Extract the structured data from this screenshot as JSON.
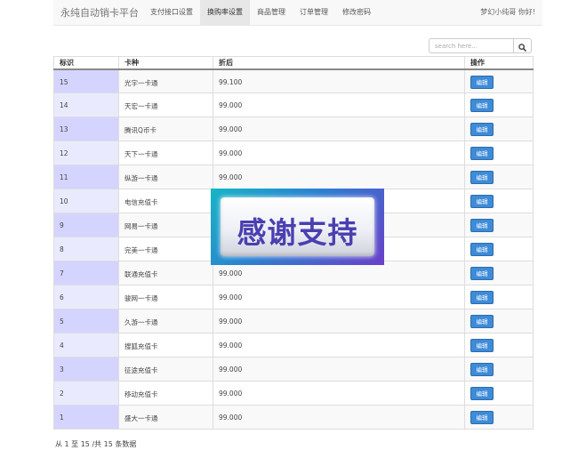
{
  "navbar": {
    "brand": "永纯自动销卡平台",
    "items": [
      {
        "label": "支付接口设置"
      },
      {
        "label": "换购率设置"
      },
      {
        "label": "商品管理"
      },
      {
        "label": "订单管理"
      },
      {
        "label": "修改密码"
      }
    ],
    "user_greeting": "梦幻小纯哥 你好!"
  },
  "search": {
    "placeholder": "search here..."
  },
  "table": {
    "columns": [
      "标识",
      "卡种",
      "折后",
      "操作"
    ],
    "edit_label": "编辑",
    "rows": [
      {
        "id": "15",
        "card": "光宇一卡通",
        "rate": "99.100"
      },
      {
        "id": "14",
        "card": "天宏一卡通",
        "rate": "99.000"
      },
      {
        "id": "13",
        "card": "腾讯Q币卡",
        "rate": "99.000"
      },
      {
        "id": "12",
        "card": "天下一卡通",
        "rate": "99.000"
      },
      {
        "id": "11",
        "card": "纵游一卡通",
        "rate": "99.000"
      },
      {
        "id": "10",
        "card": "电信充值卡",
        "rate": ""
      },
      {
        "id": "9",
        "card": "网易一卡通",
        "rate": ""
      },
      {
        "id": "8",
        "card": "完美一卡通",
        "rate": ""
      },
      {
        "id": "7",
        "card": "联通充值卡",
        "rate": "99.000"
      },
      {
        "id": "6",
        "card": "骏网一卡通",
        "rate": "99.000"
      },
      {
        "id": "5",
        "card": "久游一卡通",
        "rate": "99.000"
      },
      {
        "id": "4",
        "card": "搜狐充值卡",
        "rate": "99.000"
      },
      {
        "id": "3",
        "card": "征途充值卡",
        "rate": "99.000"
      },
      {
        "id": "2",
        "card": "移动充值卡",
        "rate": "99.000"
      },
      {
        "id": "1",
        "card": "盛大一卡通",
        "rate": "99.000"
      }
    ]
  },
  "footer": {
    "info": "从 1 至 15 /共 15 条数据"
  },
  "overlay": {
    "text": "感谢支持"
  },
  "icons": {
    "search_button": "search-icon"
  }
}
